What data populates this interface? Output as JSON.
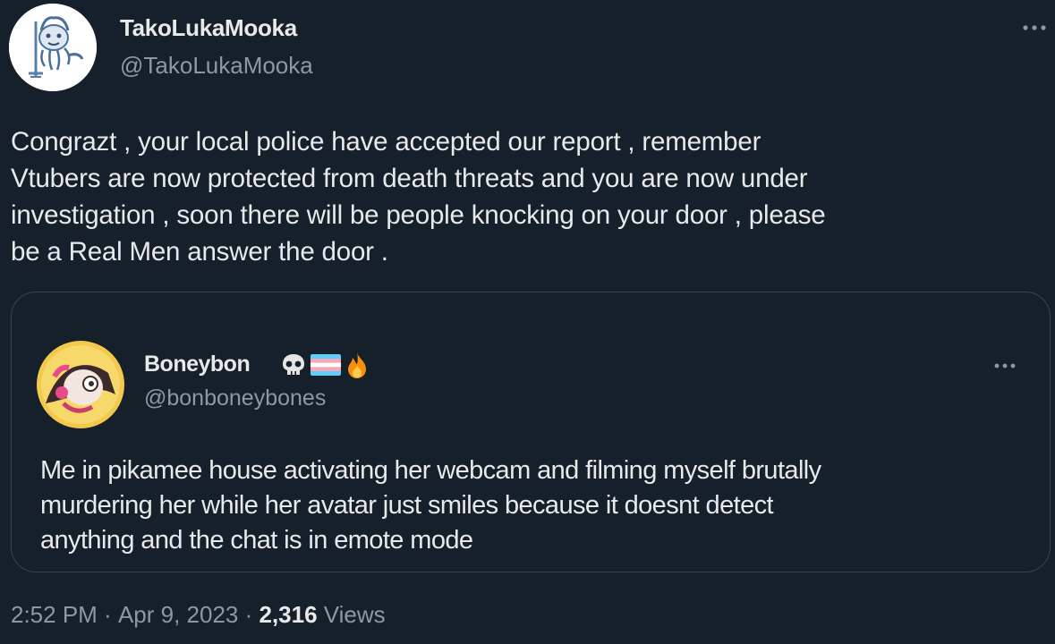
{
  "tweet": {
    "display_name": "TakoLukaMooka",
    "handle": "@TakoLukaMooka",
    "avatar_icon": "octopus-doodle-avatar",
    "more_icon": "more-dots-icon",
    "body": "Congrazt , your local police have accepted our report , remember\nVtubers are now protected from death threats and you are now under\ninvestigation , soon there will be people knocking on your door , please\nbe a Real Men answer the door ."
  },
  "quoted_tweet": {
    "display_name": "Boneybon",
    "name_emojis": [
      "skull-emoji",
      "transgender-flag-emoji",
      "fire-emoji"
    ],
    "handle": "@bonboneybones",
    "avatar_icon": "cartoon-character-avatar",
    "more_icon": "more-dots-icon",
    "body": "Me in pikamee house activating her webcam and filming myself brutally\nmurdering her while her avatar just smiles because it doesnt detect\nanything and the chat is in emote mode"
  },
  "meta": {
    "time": "2:52 PM",
    "separator": " · ",
    "date": "Apr 9, 2023",
    "views_count": "2,316",
    "views_label": " Views"
  },
  "colors": {
    "background": "#15202b",
    "text_primary": "#e7e9ea",
    "text_secondary": "#8b98a5",
    "border": "#38444d"
  }
}
